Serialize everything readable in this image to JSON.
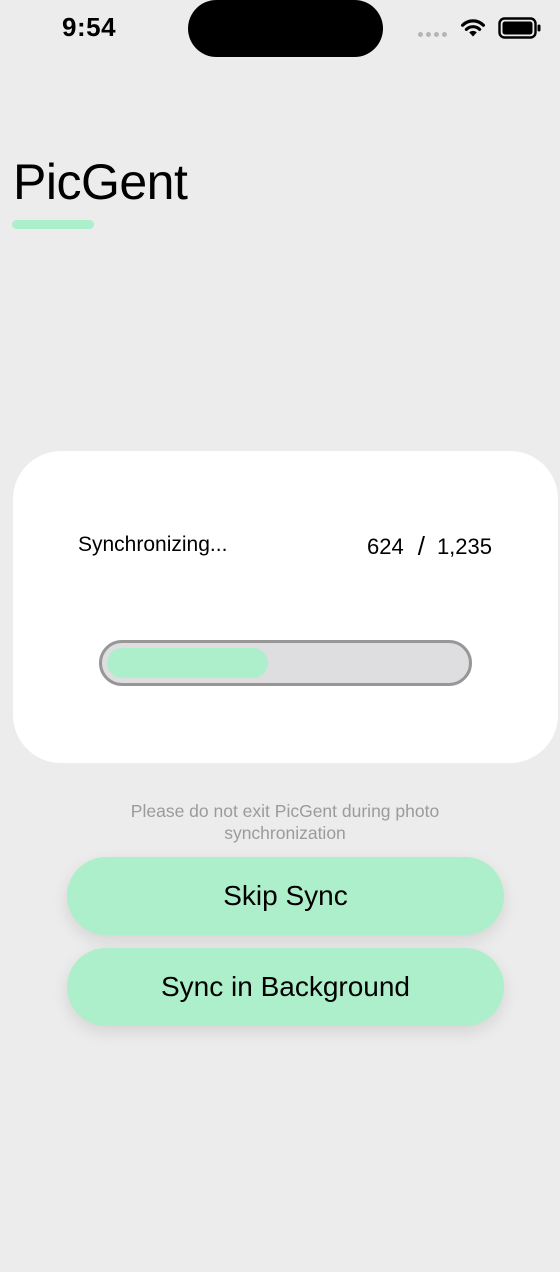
{
  "colors": {
    "accent": "#ADEECB",
    "background": "#ECECEC",
    "card": "#FFFFFF",
    "notice_text": "#9B9B9B"
  },
  "status_bar": {
    "time": "9:54",
    "icons": [
      "cellular-signal-icon",
      "wifi-icon",
      "battery-icon"
    ]
  },
  "header": {
    "title": "PicGent"
  },
  "sync_card": {
    "status": "Synchronizing...",
    "current": "624",
    "separator": "/",
    "total": "1,235",
    "progress_fraction": 0.45
  },
  "notice": "Please do not exit PicGent during photo synchronization",
  "buttons": {
    "skip_sync": "Skip Sync",
    "sync_background": "Sync in Background"
  }
}
